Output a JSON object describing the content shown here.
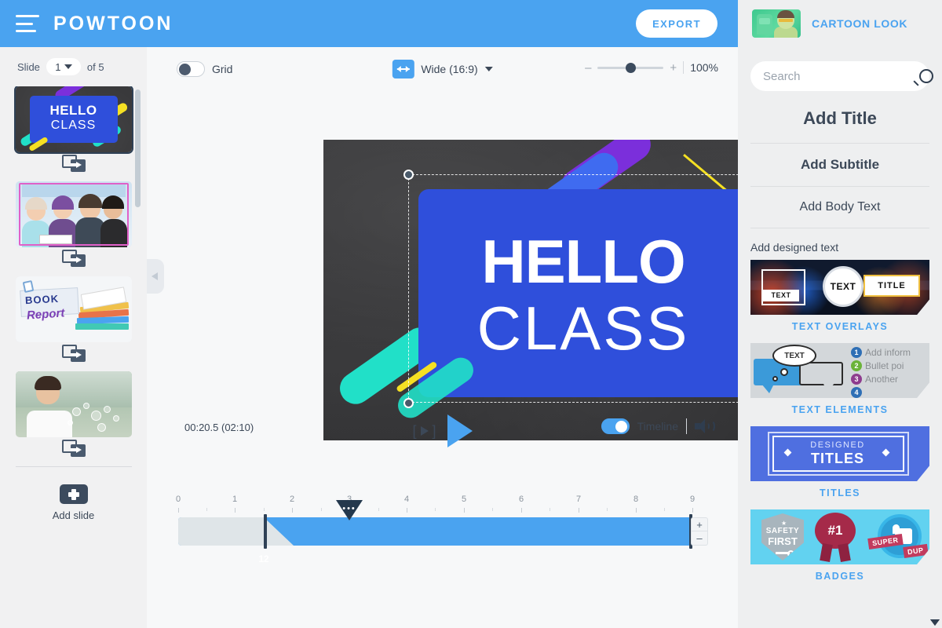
{
  "header": {
    "menu_icon": "hamburger-icon",
    "logo": "POWTOON",
    "export_label": "EXPORT",
    "look_label": "CARTOON LOOK"
  },
  "sidebar": {
    "slide_word": "Slide",
    "current_slide": "1",
    "of_word": "of",
    "total_slides": "5",
    "add_slide_label": "Add slide",
    "slides": [
      {
        "name": "slide-1-hello-class",
        "hello": "HELLO",
        "class": "CLASS"
      },
      {
        "name": "slide-2-students-photo"
      },
      {
        "name": "slide-3-book-report",
        "book": "BOOK",
        "report": "Report"
      },
      {
        "name": "slide-4-boy-bubbles"
      },
      {
        "name": "slide-5-blank"
      }
    ]
  },
  "toolbar": {
    "grid_label": "Grid",
    "grid_on": false,
    "ratio_label": "Wide (16:9)",
    "zoom_minus": "–",
    "zoom_plus": "+",
    "zoom_value": "100%"
  },
  "canvas": {
    "hello_text": "HELLO",
    "class_text": "CLASS",
    "card_color": "#2f4fdb",
    "board_color": "#39393b",
    "accent_purple": "#7b2fdb",
    "accent_yellow": "#f5e023",
    "accent_cyan": "#21e0c8",
    "accent_blue": "#3f6bf0"
  },
  "playback": {
    "timecode": "00:20.5 (02:10)",
    "timeline_label": "Timeline",
    "timeline_on": true,
    "frame_icon": "step-frame-icon",
    "play_icon": "play-icon",
    "audio_icon": "speaker-icon"
  },
  "timeline": {
    "ticks": [
      "0",
      "1",
      "2",
      "3",
      "4",
      "5",
      "6",
      "7",
      "8",
      "9"
    ],
    "playhead_label": "12",
    "marker_dots": "•••",
    "zoom_in": "+",
    "zoom_out": "–"
  },
  "rightpanel": {
    "search_placeholder": "Search",
    "search_value": "",
    "options": [
      {
        "label": "Add Title",
        "name": "add-title"
      },
      {
        "label": "Add Subtitle",
        "name": "add-subtitle"
      },
      {
        "label": "Add Body Text",
        "name": "add-body-text"
      }
    ],
    "designed_label": "Add designed text",
    "categories": [
      {
        "name": "TEXT OVERLAYS",
        "t1": "TEXT",
        "t2": "TEXT",
        "t3": "TITLE"
      },
      {
        "name": "TEXT ELEMENTS",
        "bubble": "TEXT",
        "lines": [
          "Add inform",
          "Bullet poi",
          "Another"
        ],
        "nums": [
          "1",
          "2",
          "3",
          "4"
        ]
      },
      {
        "name": "TITLES",
        "top": "DESIGNED",
        "bottom": "TITLES"
      },
      {
        "name": "BADGES",
        "b1a": "SAFETY",
        "b1b": "FIRST",
        "b2": "#1",
        "b3a": "SUPER",
        "b3b": "DUP"
      }
    ]
  }
}
